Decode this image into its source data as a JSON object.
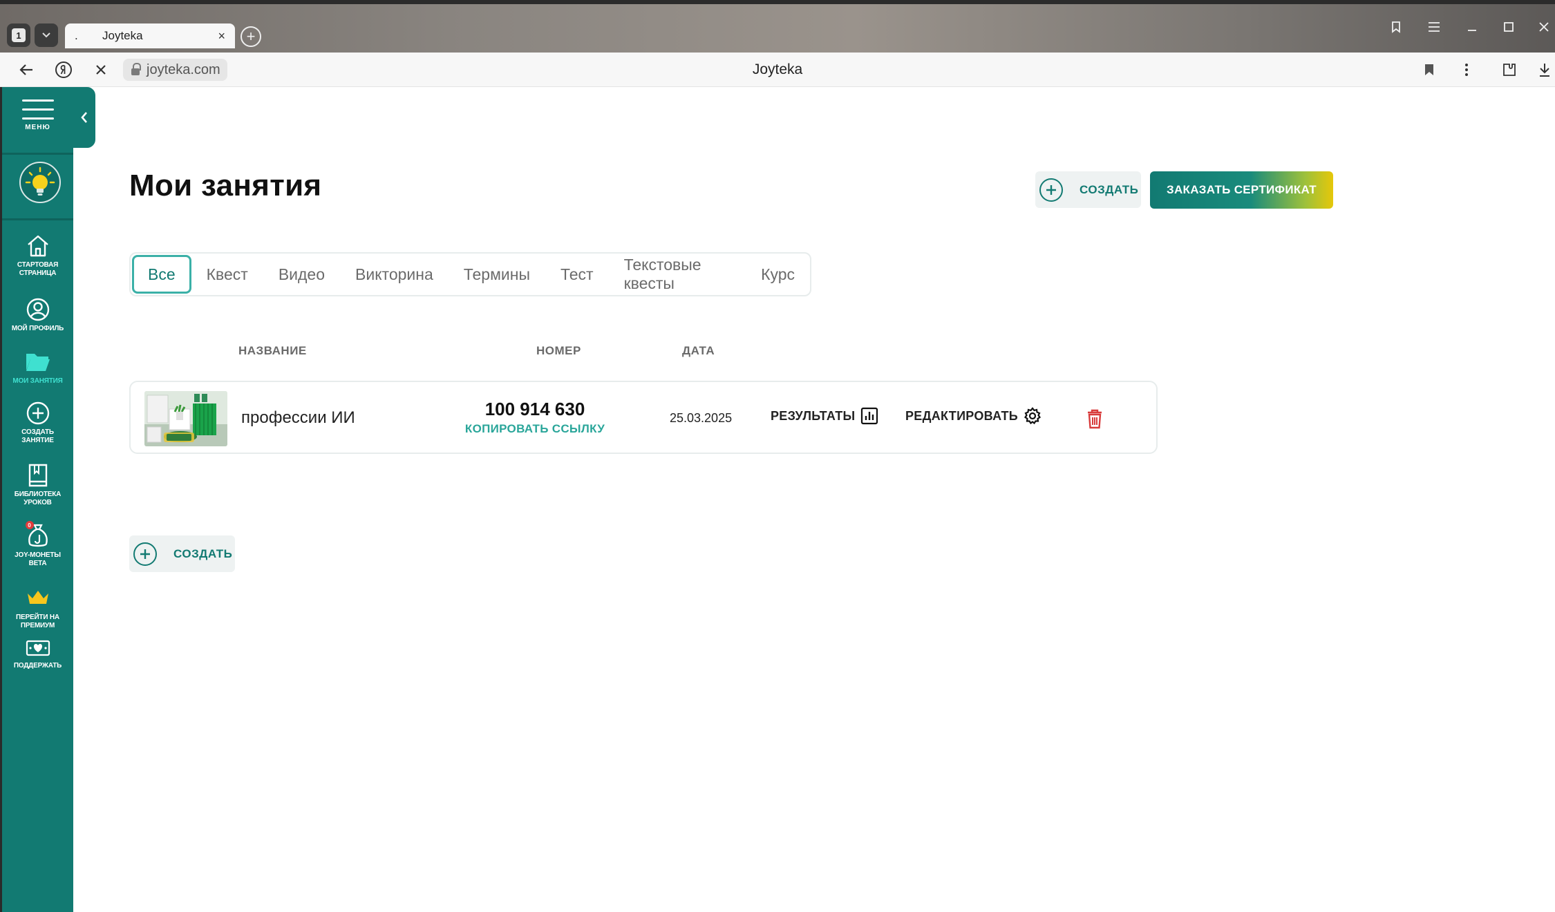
{
  "browser": {
    "window_badge": "1",
    "tab": {
      "title": "Joyteka",
      "prefix": ".",
      "close_glyph": "×"
    },
    "new_tab_glyph": "+",
    "url": "joyteka.com",
    "page_title": "Joyteka",
    "icons": [
      "back-icon",
      "yandex-icon",
      "stop-icon",
      "lock-icon",
      "bookmark-icon",
      "kebab-icon",
      "extensions-icon",
      "download-icon"
    ]
  },
  "sidebar": {
    "menu_label": "МЕНЮ",
    "items": [
      {
        "label1": "СТАРТОВАЯ",
        "label2": "СТРАНИЦА",
        "icon": "home-icon"
      },
      {
        "label1": "МОЙ ПРОФИЛЬ",
        "label2": "",
        "icon": "profile-icon"
      },
      {
        "label1": "МОИ ЗАНЯТИЯ",
        "label2": "",
        "icon": "folder-icon"
      },
      {
        "label1": "СОЗДАТЬ",
        "label2": "ЗАНЯТИЕ",
        "icon": "plus-circle-icon"
      },
      {
        "label1": "БИБЛИОТЕКА",
        "label2": "УРОКОВ",
        "icon": "book-icon"
      },
      {
        "label1": "JOY-МОНЕТЫ",
        "label2": "BETA",
        "icon": "money-bag-icon",
        "badge": "0"
      },
      {
        "label1": "ПЕРЕЙТИ НА",
        "label2": "ПРЕМИУМ",
        "icon": "crown-icon"
      },
      {
        "label1": "ПОДДЕРЖАТЬ",
        "label2": "",
        "icon": "donate-icon"
      }
    ],
    "active_color": "#3fe0d0",
    "bg_color": "#127a72"
  },
  "main": {
    "title": "Мои занятия",
    "create_label": "СОЗДАТЬ",
    "certificate_label": "ЗАКАЗАТЬ СЕРТИФИКАТ",
    "filters": [
      "Все",
      "Квест",
      "Видео",
      "Викторина",
      "Термины",
      "Тест",
      "Текстовые квесты",
      "Курс"
    ],
    "active_filter": "Все",
    "columns": {
      "name": "НАЗВАНИЕ",
      "number": "НОМЕР",
      "date": "ДАТА"
    },
    "rows": [
      {
        "name": "профессии ИИ",
        "number": "100 914 630",
        "copy_link": "КОПИРОВАТЬ ССЫЛКУ",
        "date": "25.03.2025",
        "results": "РЕЗУЛЬТАТЫ",
        "edit": "РЕДАКТИРОВАТЬ"
      }
    ]
  }
}
